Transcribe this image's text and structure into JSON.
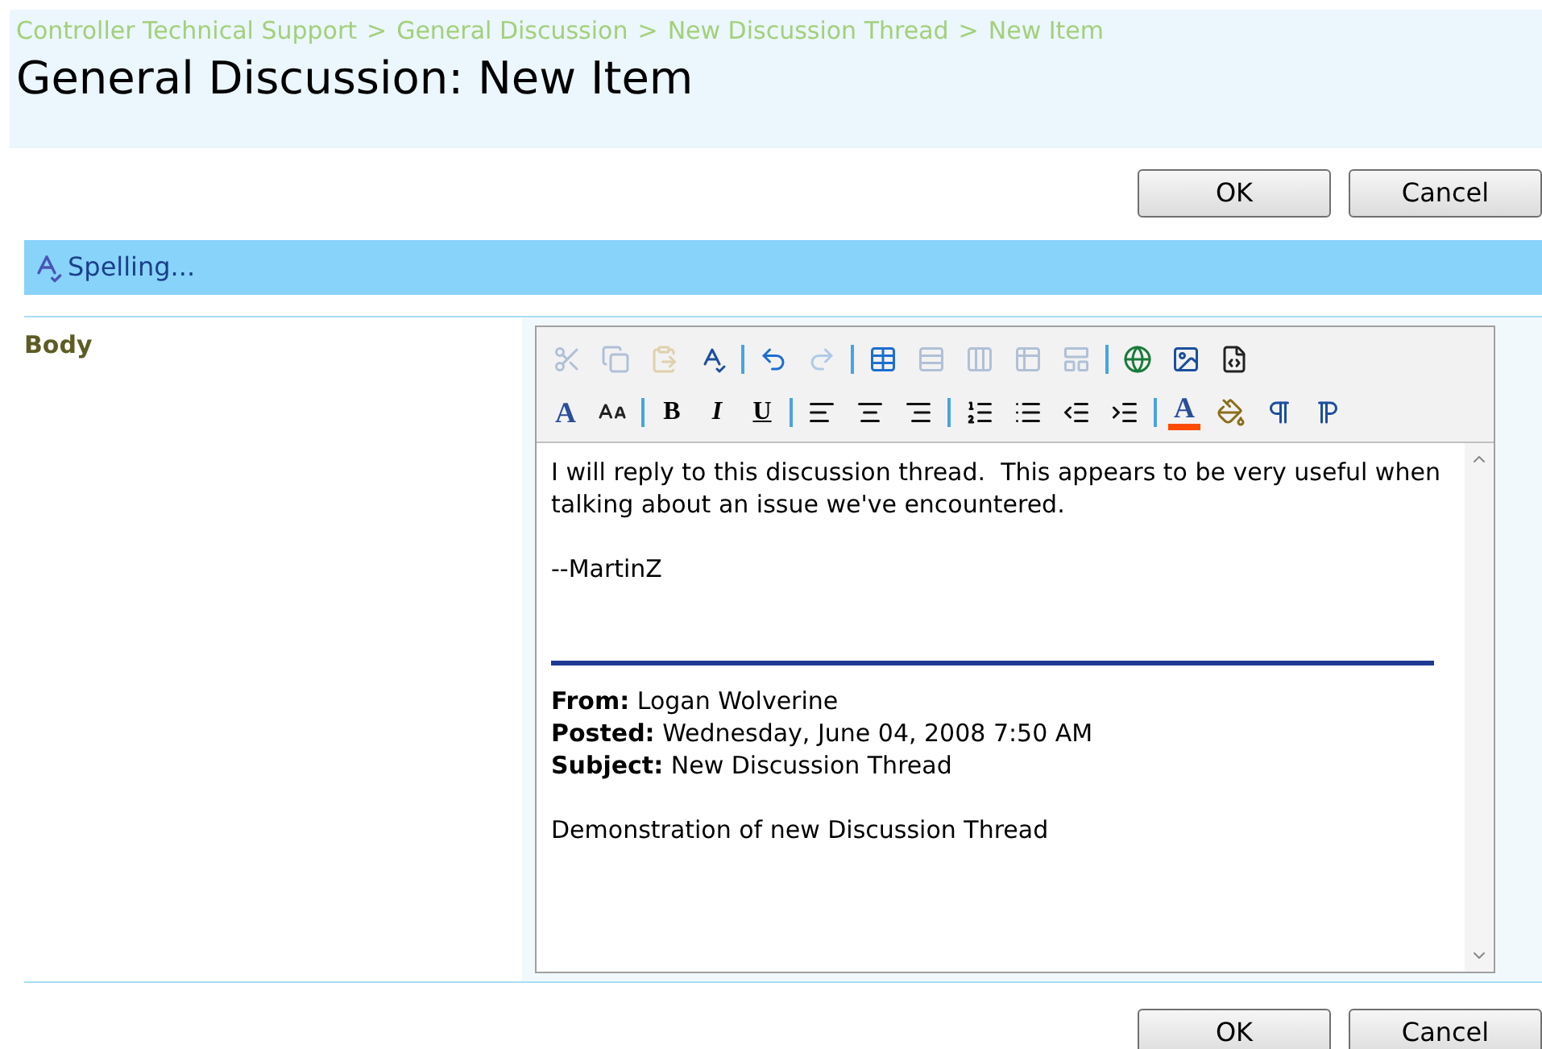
{
  "breadcrumb": [
    "Controller Technical Support",
    "General Discussion",
    "New Discussion Thread",
    "New Item"
  ],
  "breadcrumb_separator": ">",
  "title": "General Discussion: New Item",
  "top_buttons": [
    "OK",
    "Cancel"
  ],
  "spelling": {
    "label": "Spelling..."
  },
  "field": {
    "label": "Body"
  },
  "toolbar": [
    [
      {
        "kind": "cut",
        "disabled": true
      },
      {
        "kind": "copy",
        "disabled": true
      },
      {
        "kind": "paste",
        "disabled": true
      },
      {
        "kind": "spell",
        "disabled": false
      },
      {
        "kind": "separator"
      },
      {
        "kind": "undo",
        "disabled": false
      },
      {
        "kind": "redo",
        "disabled": true
      },
      {
        "kind": "separator"
      },
      {
        "kind": "table",
        "disabled": false
      },
      {
        "kind": "insert-row",
        "disabled": true
      },
      {
        "kind": "insert-column",
        "disabled": true
      },
      {
        "kind": "merge",
        "disabled": true
      },
      {
        "kind": "split",
        "disabled": true
      },
      {
        "kind": "separator"
      },
      {
        "kind": "link",
        "disabled": false
      },
      {
        "kind": "image",
        "disabled": false
      },
      {
        "kind": "source",
        "disabled": false
      }
    ],
    [
      {
        "kind": "font",
        "label": "A",
        "disabled": false
      },
      {
        "kind": "size",
        "disabled": false
      },
      {
        "kind": "separator"
      },
      {
        "kind": "bold",
        "label": "B",
        "disabled": false
      },
      {
        "kind": "italic",
        "label": "I",
        "disabled": false
      },
      {
        "kind": "underline",
        "label": "U",
        "disabled": false
      },
      {
        "kind": "separator"
      },
      {
        "kind": "align-left",
        "disabled": false
      },
      {
        "kind": "align-center",
        "disabled": false
      },
      {
        "kind": "align-right",
        "disabled": false
      },
      {
        "kind": "separator"
      },
      {
        "kind": "numbered-list",
        "disabled": false
      },
      {
        "kind": "bullet-list",
        "disabled": false
      },
      {
        "kind": "outdent",
        "disabled": false
      },
      {
        "kind": "indent",
        "disabled": false
      },
      {
        "kind": "separator"
      },
      {
        "kind": "font-color",
        "label": "A",
        "color": "#ff4b00",
        "disabled": false
      },
      {
        "kind": "fill",
        "disabled": false
      },
      {
        "kind": "ltr",
        "disabled": false
      },
      {
        "kind": "rtl",
        "disabled": false
      }
    ]
  ],
  "body": {
    "reply": [
      "I will reply to this discussion thread.  This appears to be very useful when talking about an issue we've encountered.",
      "--MartinZ"
    ],
    "quote_header": [
      "**From:** Logan Wolverine",
      "**Posted:** Wednesday, June 04, 2008 7:50 AM",
      "**Subject:** New Discussion Thread"
    ],
    "quote_body": "Demonstration of new Discussion Thread"
  },
  "bottom_buttons": [
    "OK",
    "Cancel"
  ]
}
